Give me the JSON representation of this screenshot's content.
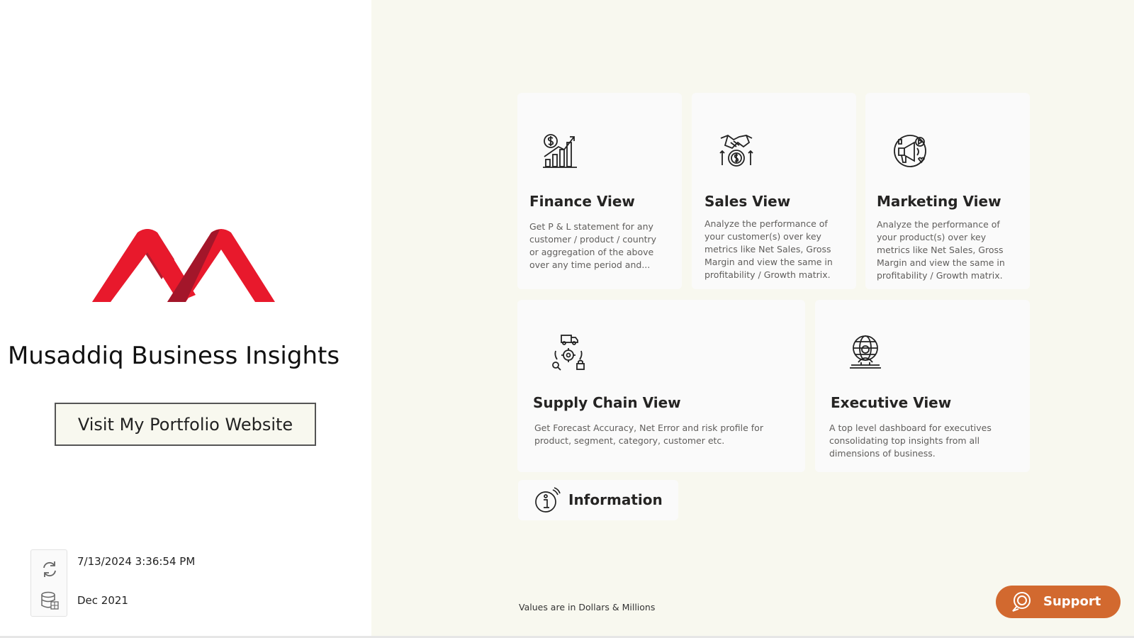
{
  "brand": {
    "title": "Musaddiq Business Insights",
    "primary_color": "#e8192c",
    "shadow_color": "#a3162a"
  },
  "portfolio_button": {
    "label": "Visit My Portfolio Website"
  },
  "refresh": {
    "timestamp": "7/13/2024 3:36:54 PM",
    "data_period": "Dec 2021",
    "refresh_icon": "refresh-icon",
    "database_icon": "database-icon"
  },
  "cards": {
    "finance": {
      "title": "Finance View",
      "description": "Get P & L statement for any customer / product / country or aggregation of the above over any time period and...",
      "icon": "finance-chart-icon"
    },
    "sales": {
      "title": "Sales View",
      "description": "Analyze the performance of your customer(s) over key metrics like Net Sales, Gross Margin and view the same in profitability / Growth matrix.",
      "icon": "handshake-dollar-icon"
    },
    "marketing": {
      "title": "Marketing View",
      "description": "Analyze the performance of your product(s) over key metrics like Net Sales, Gross Margin and view the same in profitability / Growth matrix.",
      "icon": "megaphone-icon"
    },
    "supply_chain": {
      "title": "Supply Chain View",
      "description": "Get Forecast Accuracy, Net Error and risk profile for product, segment, category, customer etc.",
      "icon": "supply-chain-icon"
    },
    "executive": {
      "title": "Executive View",
      "description": "A top level dashboard for executives consolidating top insights from all dimensions of business.",
      "icon": "global-executive-icon"
    }
  },
  "info": {
    "label": "Information",
    "icon": "info-icon"
  },
  "footnote": "Values are in Dollars & Millions",
  "support": {
    "label": "Support",
    "color": "#d2692f",
    "icon": "support-icon"
  },
  "colors": {
    "background": "#f8f8ef",
    "card": "#fafafa",
    "panel": "#ffffff"
  }
}
